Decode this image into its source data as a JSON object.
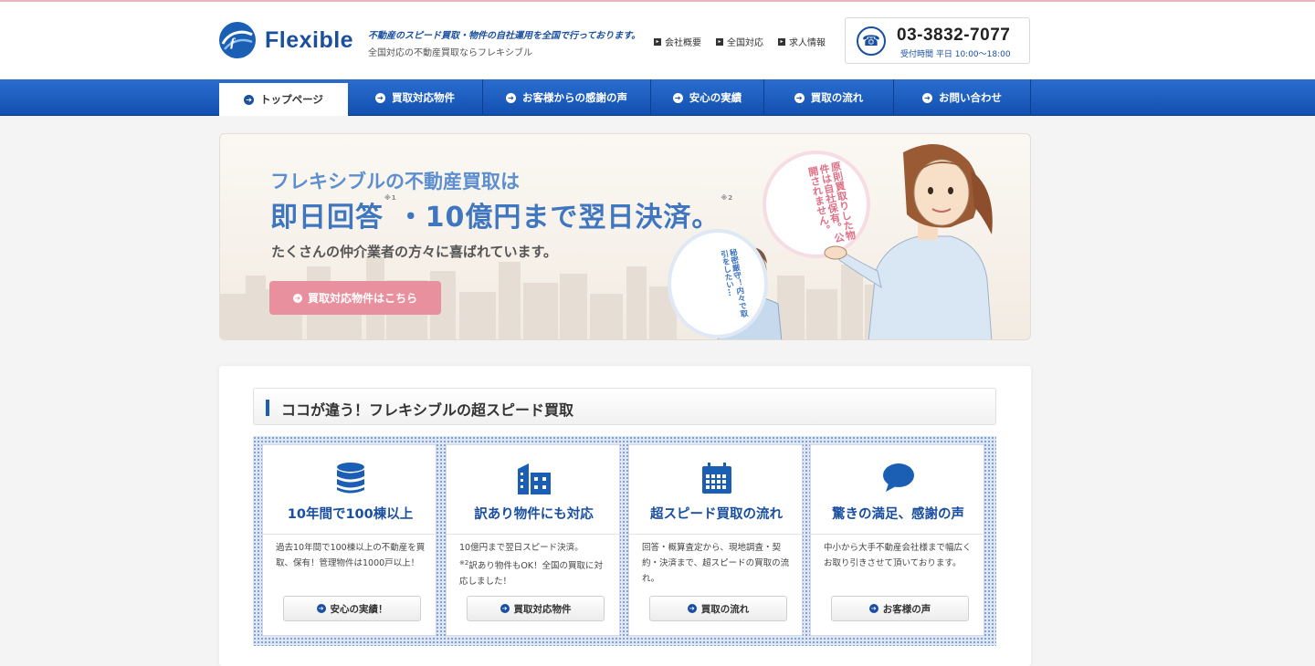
{
  "brand": {
    "name": "Flexible",
    "tagline_main": "不動産のスピード買取・物件の自社運用を全国で行っております。",
    "tagline_sub": "全国対応の不動産買取ならフレキシブル",
    "accent": "#1a4fa0"
  },
  "util_nav": [
    "会社概要",
    "全国対応",
    "求人情報"
  ],
  "contact": {
    "tel": "03-3832-7077",
    "hours": "受付時間 平日 10:00～18:00",
    "icon": "phone-icon"
  },
  "gnav": [
    {
      "label": "トップページ",
      "active": true
    },
    {
      "label": "買取対応物件",
      "active": false
    },
    {
      "label": "お客様からの感謝の声",
      "active": false
    },
    {
      "label": "安心の実績",
      "active": false
    },
    {
      "label": "買取の流れ",
      "active": false
    },
    {
      "label": "お問い合わせ",
      "active": false
    }
  ],
  "hero": {
    "line1": "フレキシブルの不動産買取は",
    "line2a": "即日回答",
    "note1": "※1",
    "line2b": "・10億円まで翌日決済。",
    "note2": "※2",
    "line3": "たくさんの仲介業者の方々に喜ばれています。",
    "cta": "買取対応物件はこちら",
    "bubble_woman": "原則買取りした物件は自社保有。公開されません。",
    "bubble_man": "秘密厳守！内々で取引をしたい…"
  },
  "section": {
    "title": "ココが違う！フレキシブルの超スピード買取",
    "cards": [
      {
        "icon": "database-icon",
        "title": "10年間で100棟以上",
        "body": "過去10年間で100棟以上の不動産を買取、保有！管理物件は1000戸以上！",
        "button": "安心の実績！"
      },
      {
        "icon": "building-icon",
        "title": "訳あり物件にも対応",
        "body_a": "10億円まで翌日スピード決済。",
        "body_note": "※2",
        "body_b": "訳あり物件もOK！全国の買取に対応しました！",
        "button": "買取対応物件"
      },
      {
        "icon": "calendar-icon",
        "title": "超スピード買取の流れ",
        "body": "回答・概算査定から、現地調査・契約・決済まで、超スピードの買取の流れ。",
        "button": "買取の流れ"
      },
      {
        "icon": "speech-bubble-icon",
        "title": "驚きの満足、感謝の声",
        "body": "中小から大手不動産会社様まで幅広くお取り引きさせて頂いております。",
        "button": "お客様の声"
      }
    ]
  }
}
